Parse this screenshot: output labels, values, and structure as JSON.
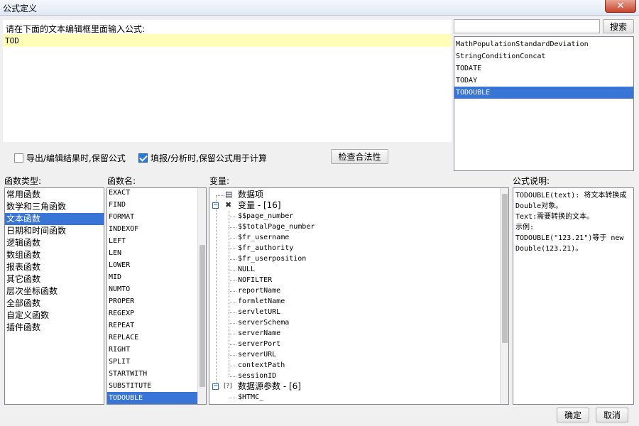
{
  "window": {
    "title": "公式定义",
    "close_glyph": "✕"
  },
  "editor": {
    "label": "请在下面的文本编辑框里面输入公式:",
    "value": "TOD"
  },
  "options": {
    "export_keep_formula": {
      "label": "导出/编辑结果时,保留公式",
      "checked": false
    },
    "fill_keep_formula": {
      "label": "填报/分析时,保留公式用于计算",
      "checked": true
    },
    "check_validity_label": "检查合法性"
  },
  "search": {
    "value": "",
    "button_label": "搜索"
  },
  "suggestions": [
    {
      "text": "MathPopulationStandardDeviation",
      "selected": false
    },
    {
      "text": "StringConditionConcat",
      "selected": false
    },
    {
      "text": "TODATE",
      "selected": false
    },
    {
      "text": "TODAY",
      "selected": false
    },
    {
      "text": "TODOUBLE",
      "selected": true
    }
  ],
  "function_types": {
    "label": "函数类型:",
    "items": [
      {
        "text": "常用函数",
        "selected": false
      },
      {
        "text": "数学和三角函数",
        "selected": false
      },
      {
        "text": "文本函数",
        "selected": true
      },
      {
        "text": "日期和时间函数",
        "selected": false
      },
      {
        "text": "逻辑函数",
        "selected": false
      },
      {
        "text": "数组函数",
        "selected": false
      },
      {
        "text": "报表函数",
        "selected": false
      },
      {
        "text": "其它函数",
        "selected": false
      },
      {
        "text": "层次坐标函数",
        "selected": false
      },
      {
        "text": "全部函数",
        "selected": false
      },
      {
        "text": "自定义函数",
        "selected": false
      },
      {
        "text": "插件函数",
        "selected": false
      }
    ]
  },
  "function_names": {
    "label": "函数名:",
    "items": [
      {
        "text": "EXACT",
        "selected": false
      },
      {
        "text": "FIND",
        "selected": false
      },
      {
        "text": "FORMAT",
        "selected": false
      },
      {
        "text": "INDEXOF",
        "selected": false
      },
      {
        "text": "LEFT",
        "selected": false
      },
      {
        "text": "LEN",
        "selected": false
      },
      {
        "text": "LOWER",
        "selected": false
      },
      {
        "text": "MID",
        "selected": false
      },
      {
        "text": "NUMTO",
        "selected": false
      },
      {
        "text": "PROPER",
        "selected": false
      },
      {
        "text": "REGEXP",
        "selected": false
      },
      {
        "text": "REPEAT",
        "selected": false
      },
      {
        "text": "REPLACE",
        "selected": false
      },
      {
        "text": "RIGHT",
        "selected": false
      },
      {
        "text": "SPLIT",
        "selected": false
      },
      {
        "text": "STARTWITH",
        "selected": false
      },
      {
        "text": "SUBSTITUTE",
        "selected": false
      },
      {
        "text": "TODOUBLE",
        "selected": true
      }
    ]
  },
  "variables": {
    "label": "变量:",
    "data_item": {
      "text": "数据项",
      "icon": "table-icon"
    },
    "variable_group": {
      "text": "变量 - [16]",
      "icon": "variable-icon",
      "toggle": "−"
    },
    "variable_items": [
      "$$page_number",
      "$$totalPage_number",
      "$fr_username",
      "$fr_authority",
      "$fr_userposition",
      "NULL",
      "NOFILTER",
      "reportName",
      "formletName",
      "servletURL",
      "serverSchema",
      "serverName",
      "serverPort",
      "serverURL",
      "contextPath",
      "sessionID"
    ],
    "datasource_group": {
      "text": "数据源参数 - [6]",
      "icon": "parameter-icon",
      "toggle": "−"
    },
    "datasource_items": [
      "$HTMC_"
    ]
  },
  "description": {
    "label": "公式说明:",
    "lines": [
      "TODOUBLE(text): 将文本转换成Double对象。",
      "Text:需要转换的文本。",
      "示例:",
      "TODOUBLE(\"123.21\")等于 new Double(123.21)。"
    ]
  },
  "footer": {
    "ok_label": "确定",
    "cancel_label": "取消"
  },
  "colors": {
    "selection": "#3875d7",
    "editor_bg": "#fffdb8"
  }
}
